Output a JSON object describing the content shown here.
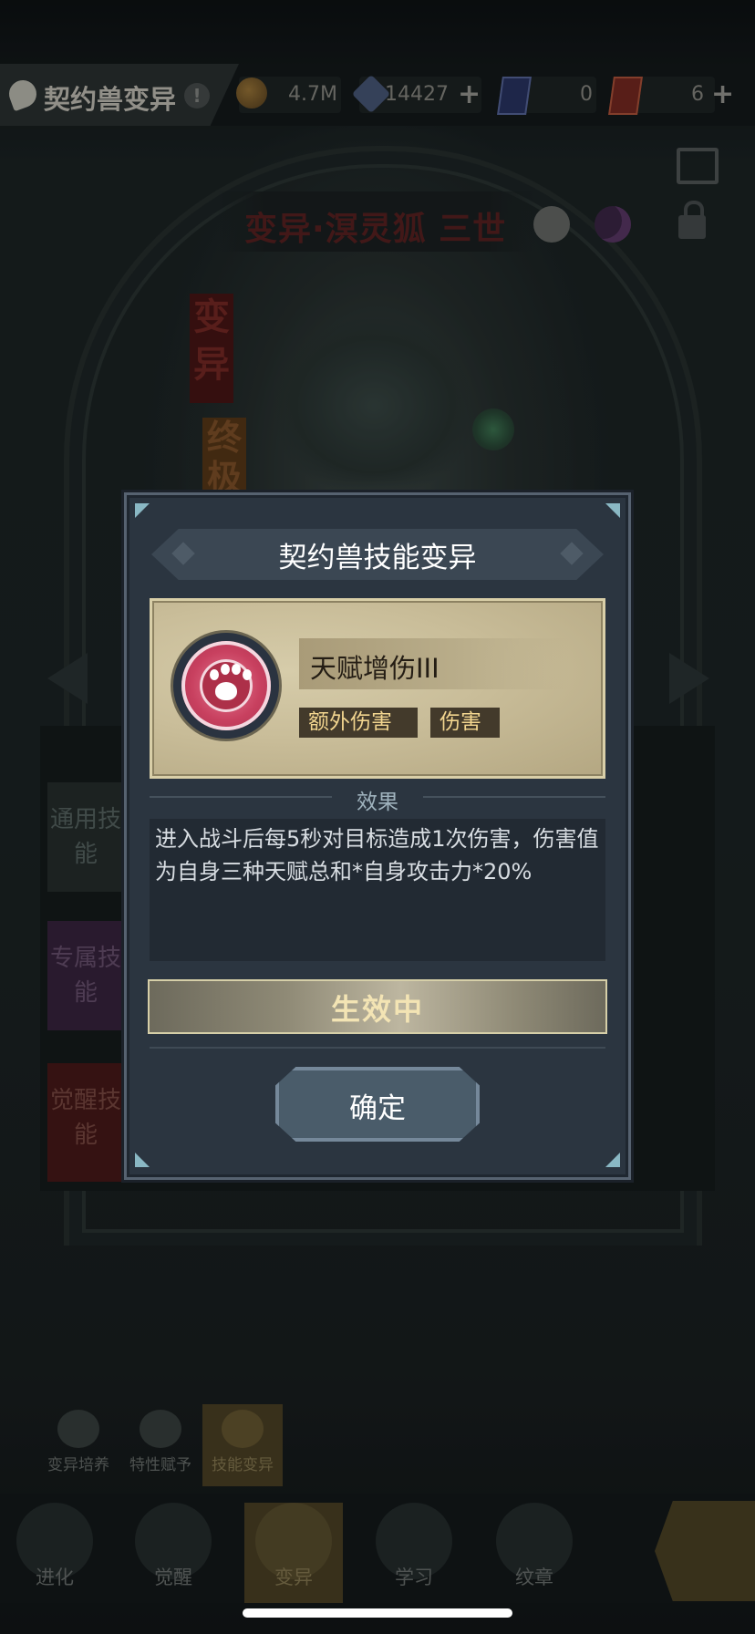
{
  "header": {
    "title": "契约兽变异",
    "resources": [
      {
        "icon": "gold-coin-icon",
        "value": "4.7M"
      },
      {
        "icon": "crystal-icon",
        "value": "14427",
        "has_plus": true
      },
      {
        "icon": "blue-card-icon",
        "value": "0"
      },
      {
        "icon": "red-card-icon",
        "value": "6",
        "has_plus": true
      }
    ]
  },
  "beast": {
    "name": "变异·溟灵狐 三世",
    "ribbon_mutation": "变异",
    "ribbon_final": "终极"
  },
  "side_tabs": [
    "通用技能",
    "专属技能",
    "觉醒技能"
  ],
  "sub_tabs": [
    {
      "label": "变异培养",
      "active": false
    },
    {
      "label": "特性赋予",
      "active": false
    },
    {
      "label": "技能变异",
      "active": true
    }
  ],
  "bottom_nav": [
    {
      "label": "进化",
      "active": false
    },
    {
      "label": "觉醒",
      "active": false
    },
    {
      "label": "变异",
      "active": true
    },
    {
      "label": "学习",
      "active": false
    },
    {
      "label": "纹章",
      "active": false
    }
  ],
  "modal": {
    "title": "契约兽技能变异",
    "skill": {
      "name": "天赋增伤III",
      "icon": "paw-icon",
      "tags": [
        "额外伤害",
        "伤害"
      ]
    },
    "effect_label": "效果",
    "effect_text": "进入战斗后每5秒对目标造成1次伤害，伤害值为自身三种天赋总和*自身攻击力*20%",
    "status_label": "生效中",
    "confirm_label": "确定"
  },
  "colors": {
    "modal_bg": "#2b3540",
    "skill_card_bg": "#c9bd99",
    "tag_text": "#f2d58f",
    "skill_icon": "#c8405f",
    "status_text": "#f3e4b4"
  }
}
